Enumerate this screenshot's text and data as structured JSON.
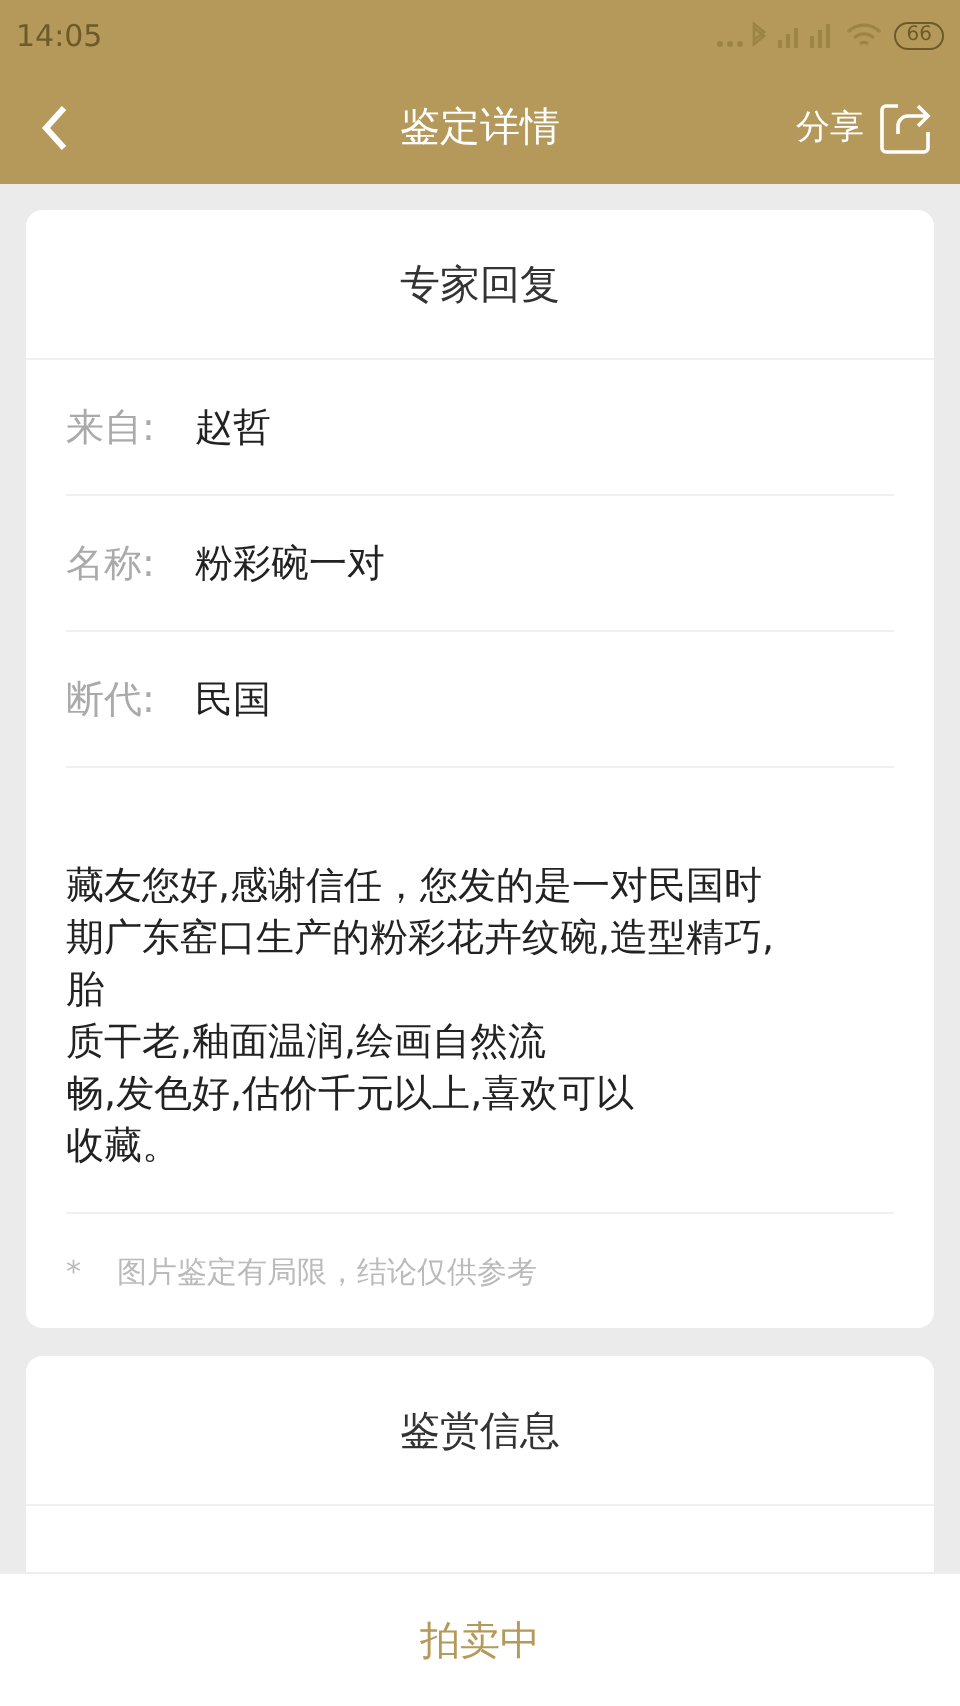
{
  "status_bar": {
    "time": "14:05",
    "battery": "66"
  },
  "nav": {
    "title": "鉴定详情",
    "share": "分享"
  },
  "reply_card": {
    "title": "专家回复",
    "fields": [
      {
        "label": "来自:",
        "value": "赵哲"
      },
      {
        "label": "名称:",
        "value": "粉彩碗一对"
      },
      {
        "label": "断代:",
        "value": "民国"
      }
    ],
    "message_lines": [
      "藏友您好,感谢信任，您发的是一对民国时",
      "期广东窑口生产的粉彩花卉纹碗,造型精巧,",
      "胎",
      "质干老,釉面温润,绘画自然流",
      "畅,发色好,估价千元以上,喜欢可以",
      "收藏。"
    ],
    "note_mark": "*",
    "note": "图片鉴定有局限，结论仅供参考"
  },
  "info_card": {
    "title": "鉴赏信息"
  },
  "bottom_button": "拍卖中"
}
